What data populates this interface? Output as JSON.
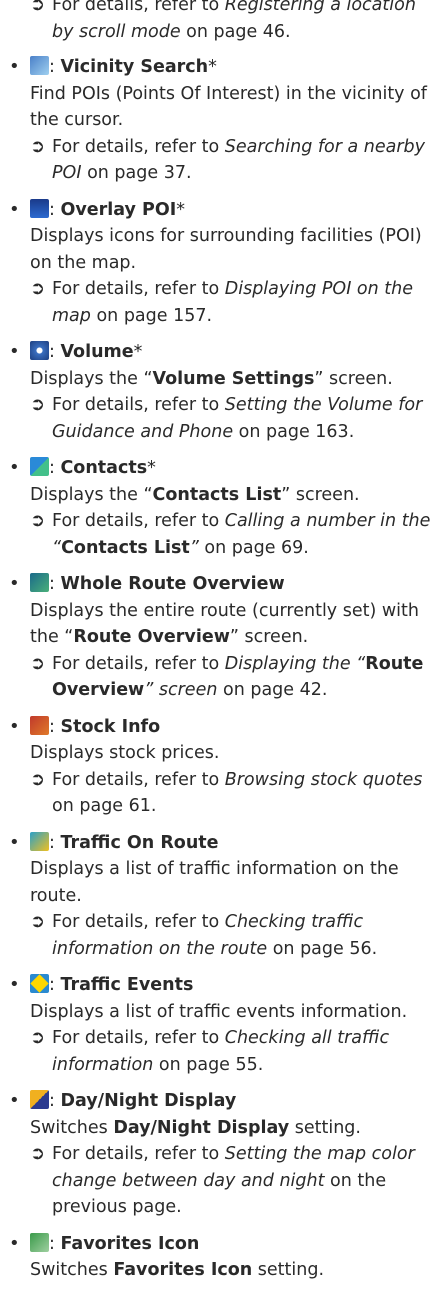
{
  "top_ref": {
    "prefix": "For details, refer to ",
    "link": "Registering a location by scroll mode",
    "suffix": " on page 46."
  },
  "items": [
    {
      "icon": "vicinity-search-icon",
      "title": "Vicinity Search",
      "star": "*",
      "description": "Find POIs (Points Of Interest) in the vicinity of the cursor.",
      "ref": {
        "prefix": "For details, refer to ",
        "link": "Searching for a nearby POI",
        "suffix": " on page 37."
      }
    },
    {
      "icon": "overlay-poi-icon",
      "title": "Overlay POI",
      "star": "*",
      "description": "Displays icons for surrounding facilities (POI) on the map.",
      "ref": {
        "prefix": "For details, refer to ",
        "link": "Displaying POI on the map",
        "suffix": " on page 157."
      }
    },
    {
      "icon": "volume-icon",
      "title": "Volume",
      "star": "*",
      "desc_prefix": "Displays the “",
      "desc_bold": "Volume Settings",
      "desc_suffix": "” screen.",
      "ref": {
        "prefix": "For details, refer to ",
        "link": "Setting the Volume for Guidance and Phone",
        "suffix": " on page 163."
      }
    },
    {
      "icon": "contacts-icon",
      "title": "Contacts",
      "star": "*",
      "desc_prefix": "Displays the “",
      "desc_bold": "Contacts List",
      "desc_suffix": "” screen.",
      "ref": {
        "prefix": "For details, refer to ",
        "link": "Calling a number in the “",
        "link_bold": "Contacts List",
        "link_end": "”",
        "suffix": " on page 69."
      }
    },
    {
      "icon": "whole-route-overview-icon",
      "title": "Whole Route Overview",
      "star": "",
      "desc_prefix": "Displays the entire route (currently set) with the “",
      "desc_bold": "Route Overview",
      "desc_suffix": "” screen.",
      "ref": {
        "prefix": "For details, refer to ",
        "link": "Displaying the “",
        "link_bold": "Route Overview",
        "link_end": "” screen",
        "suffix": " on page 42."
      }
    },
    {
      "icon": "stock-info-icon",
      "title": "Stock Info",
      "star": "",
      "description": "Displays stock prices.",
      "ref": {
        "prefix": "For details, refer to ",
        "link": "Browsing stock quotes",
        "suffix": " on page 61."
      }
    },
    {
      "icon": "traffic-on-route-icon",
      "title": "Traffic On Route",
      "star": "",
      "description": "Displays a list of traffic information on the route.",
      "ref": {
        "prefix": "For details, refer to ",
        "link": "Checking traffic information on the route",
        "suffix": " on page 56."
      }
    },
    {
      "icon": "traffic-events-icon",
      "title": "Traffic Events",
      "star": "",
      "description": "Displays a list of traffic events information.",
      "ref": {
        "prefix": "For details, refer to ",
        "link": "Checking all traffic information",
        "suffix": " on page 55."
      }
    },
    {
      "icon": "day-night-display-icon",
      "title": "Day/Night Display",
      "star": "",
      "desc_prefix": "Switches ",
      "desc_bold": "Day/Night Display",
      "desc_suffix": " setting.",
      "ref": {
        "prefix": "For details, refer to ",
        "link": "Setting the map color change between day and night",
        "suffix": " on the previous page."
      }
    },
    {
      "icon": "favorites-icon",
      "title": "Favorites Icon",
      "star": "",
      "desc_prefix": "Switches ",
      "desc_bold": "Favorites Icon",
      "desc_suffix": " setting."
    }
  ],
  "symbols": {
    "bullet": "•",
    "arrow": "➲",
    "separator": ": "
  }
}
